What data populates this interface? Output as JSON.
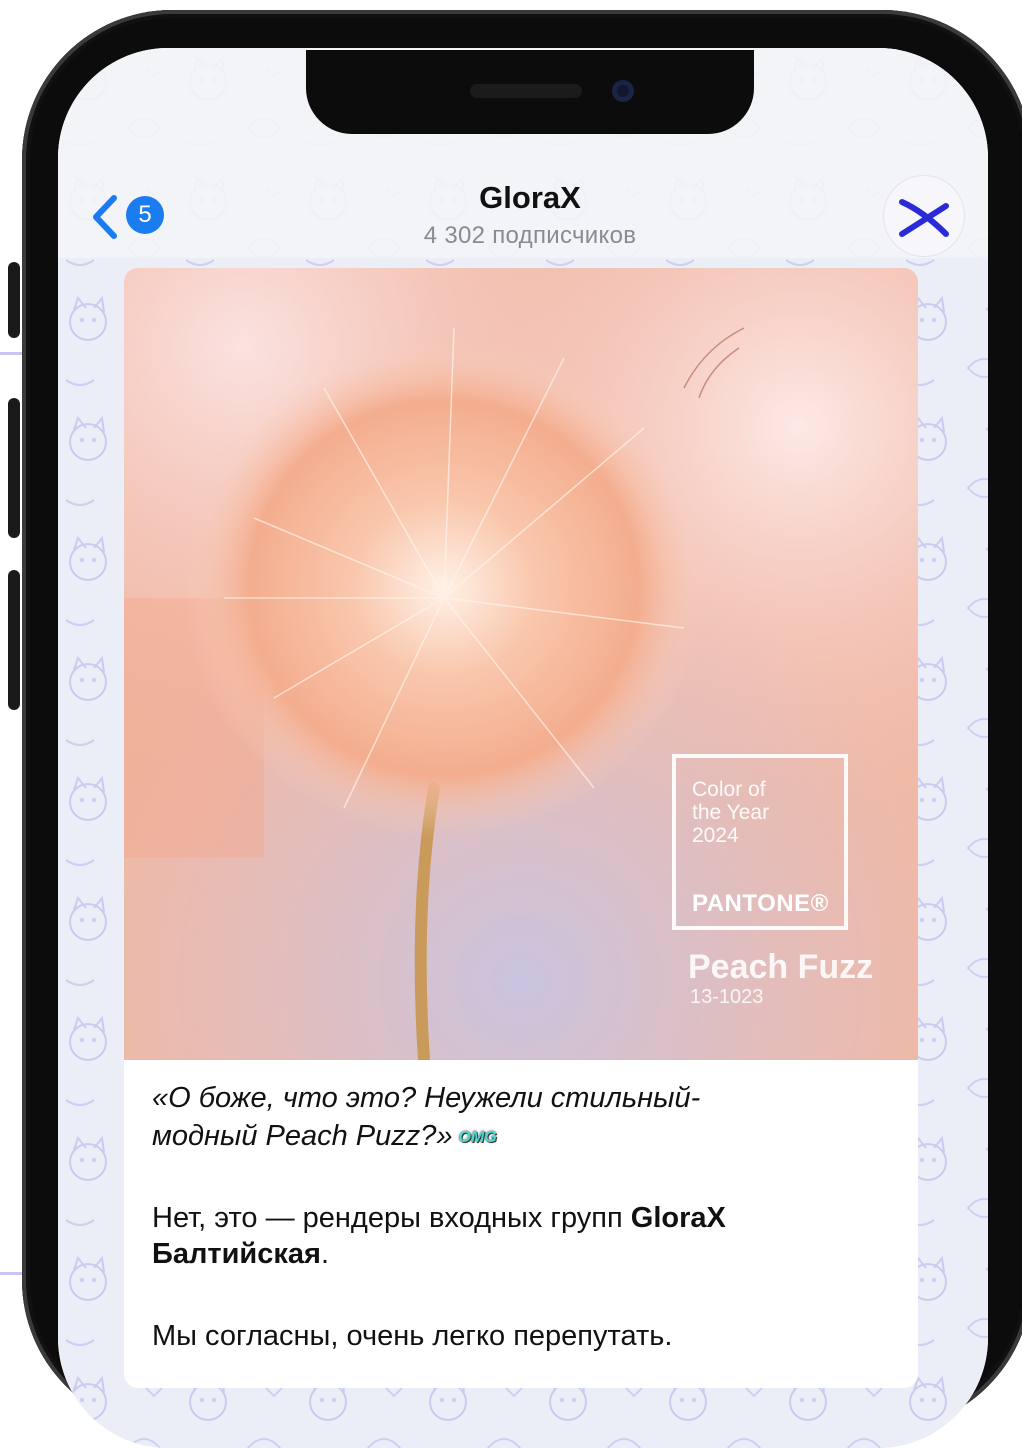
{
  "channel": {
    "title": "GloraX",
    "subscribers": "4 302 подписчиков",
    "unread_count": "5"
  },
  "post": {
    "image": {
      "pantone_lines": [
        "Color of",
        "the Year",
        "2024"
      ],
      "pantone_brand": "PANTONE®",
      "color_name": "Peach Fuzz",
      "color_code": "13-1023"
    },
    "quote_line1": "«О боже, что это? Неужели стильный-",
    "quote_line2": "модный Peach Puzz?»",
    "omg_sticker": "OMG",
    "para2_prefix": "Нет, это — рендеры входных групп ",
    "para2_bold": "GloraX Балтийская",
    "para2_suffix": ".",
    "para3": "Мы согласны, очень легко перепутать."
  },
  "colors": {
    "accent": "#1b7cf0",
    "peach": "#f6b59a",
    "logo": "#2a2ad8"
  },
  "icons": {
    "back": "chevron-left-icon",
    "avatar": "glorax-logo-icon"
  }
}
